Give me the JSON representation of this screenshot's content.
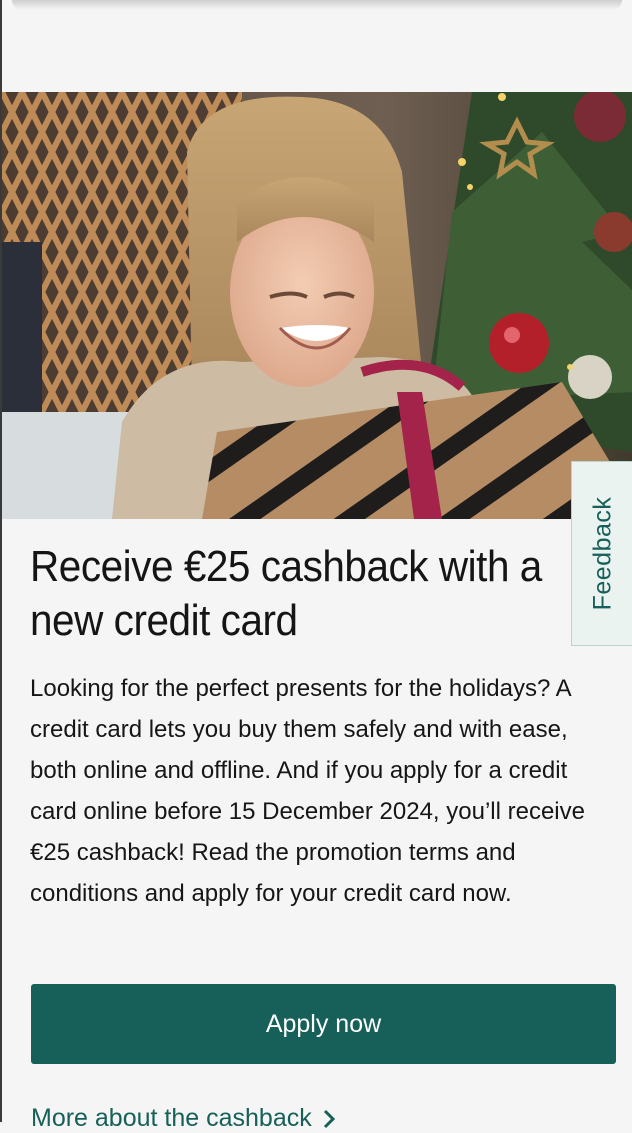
{
  "promo": {
    "image_alt": "Girl opening a striped gift box in front of a Christmas tree",
    "title": "Receive €25 cashback with a new credit card",
    "body": "Looking for the perfect presents for the holidays? A credit card lets you buy them safely and with ease, both online and offline. And if you apply for a credit card online before 15 December 2024, you’ll receive €25 cashback! Read the promotion terms and conditions and apply for your credit card now.",
    "apply_label": "Apply now",
    "more_link_label": "More about the cashback"
  },
  "feedback": {
    "label": "Feedback"
  },
  "colors": {
    "brand": "#17605a",
    "background": "#f5f5f5",
    "text": "#151515"
  },
  "icons": {
    "more_link": "chevron-right-icon"
  }
}
